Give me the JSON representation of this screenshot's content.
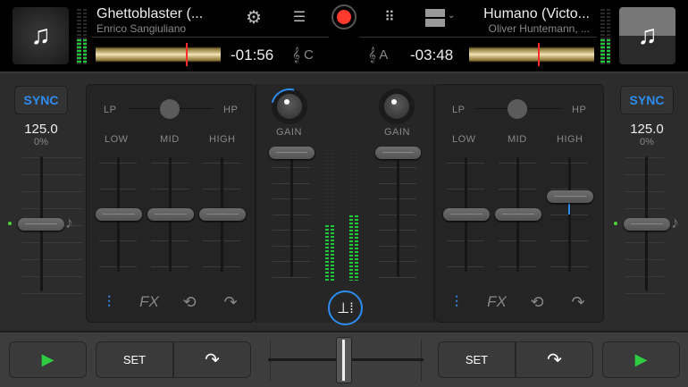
{
  "deck_left": {
    "title": "Ghettoblaster (...",
    "artist": "Enrico Sangiuliano",
    "time": "-01:56",
    "key": "C",
    "bpm": "125.0",
    "pitch": "0%",
    "sync": "SYNC",
    "playhead_position": 0.73,
    "level": 0.45
  },
  "deck_right": {
    "title": "Humano (Victo...",
    "artist": "Oliver Huntemann, ...",
    "time": "-03:48",
    "key": "A",
    "bpm": "125.0",
    "pitch": "0%",
    "sync": "SYNC",
    "playhead_position": 0.5,
    "level": 0.45
  },
  "toolbar": {
    "icons": [
      "gear-icon",
      "queue-icon",
      "record-icon",
      "grid-icon",
      "layout-icon"
    ]
  },
  "eq": {
    "lp": "LP",
    "hp": "HP",
    "low": "LOW",
    "mid": "MID",
    "high": "HIGH",
    "fx": "FX"
  },
  "mixer": {
    "gain": "GAIN",
    "left_volume": 1.0,
    "right_volume": 1.0,
    "left_level": 0.42,
    "right_level": 0.5
  },
  "bottom": {
    "set": "SET",
    "crossfader": 0.5
  },
  "colors": {
    "accent": "#2d8cf0",
    "play": "#2ecc40",
    "record": "#ff3b30"
  }
}
